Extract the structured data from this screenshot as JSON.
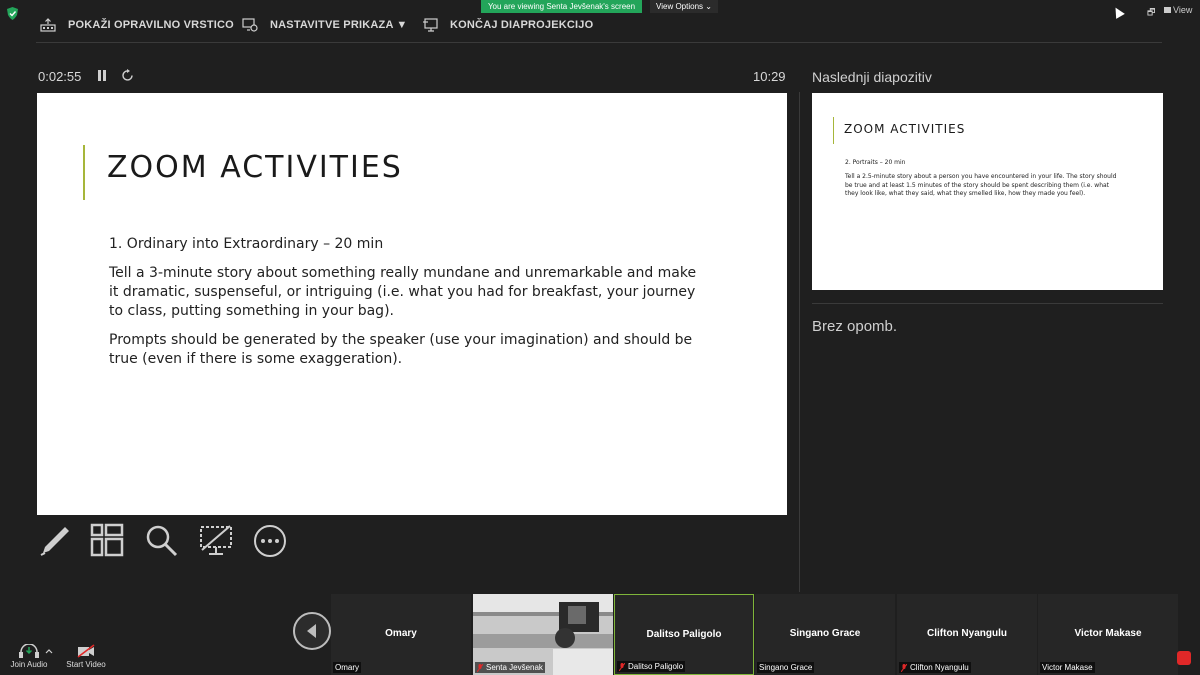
{
  "banner": {
    "viewing": "You are viewing Senta Jevšenak's screen",
    "view_options": "View Options ⌄",
    "view": "View"
  },
  "toolbar": {
    "taskbar_label": "POKAŽI OPRAVILNO VRSTICO",
    "display_settings_label": "NASTAVITVE PRIKAZA ▼",
    "end_show_label": "KONČAJ DIAPROJEKCIJO"
  },
  "presenter": {
    "elapsed": "0:02:55",
    "clock": "10:29"
  },
  "slide": {
    "title": "ZOOM ACTIVITIES",
    "paragraphs": [
      "1. Ordinary into Extraordinary – 20 min",
      "Tell a 3-minute story about something really mundane and unremarkable and make it dramatic, suspenseful, or intriguing (i.e. what you had for breakfast, your journey to class, putting something in your bag).",
      "Prompts should be generated by the speaker (use your imagination) and should be true (even if there is some exaggeration)."
    ]
  },
  "next": {
    "label": "Naslednji diapozitiv",
    "title": "ZOOM ACTIVITIES",
    "subtitle": "2. Portraits – 20 min",
    "body": "Tell a 2.5-minute story about a person you have encountered in your life. The story should be true and at least 1.5 minutes of the story should be spent describing them (i.e. what they look like, what they said, what they smelled like, how they made you feel)."
  },
  "notes": "Brez opomb.",
  "participants": [
    {
      "name": "Omary",
      "label": "Omary",
      "muted": false
    },
    {
      "name": "",
      "label": "Senta Jevšenak",
      "muted": true
    },
    {
      "name": "Dalitso Paligolo",
      "label": "Dalitso Paligolo",
      "muted": true
    },
    {
      "name": "Singano Grace",
      "label": "Singano Grace",
      "muted": false
    },
    {
      "name": "Clifton Nyangulu",
      "label": "Clifton Nyangulu",
      "muted": true
    },
    {
      "name": "Victor Makase",
      "label": "Victor Makase",
      "muted": false
    }
  ],
  "bottombar": {
    "join_audio": "Join Audio",
    "start_video": "Start Video"
  },
  "colors": {
    "accent_green": "#23a55a",
    "slide_accent": "#a6b63a",
    "active_speaker": "#7fb53a"
  }
}
